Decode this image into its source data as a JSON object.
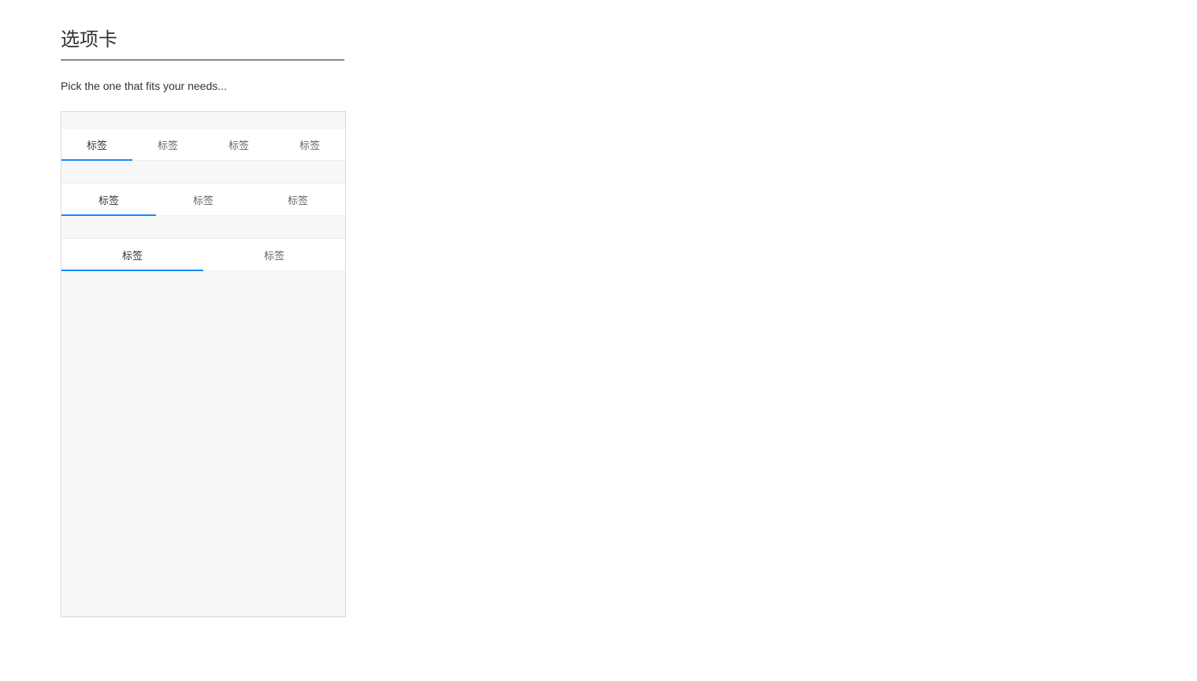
{
  "page": {
    "title": "选项卡",
    "subtitle": "Pick the one that fits your needs..."
  },
  "tabGroups": [
    {
      "count": 4,
      "activeIndex": 0,
      "tabs": [
        {
          "label": "标签"
        },
        {
          "label": "标签"
        },
        {
          "label": "标签"
        },
        {
          "label": "标签"
        }
      ]
    },
    {
      "count": 3,
      "activeIndex": 0,
      "tabs": [
        {
          "label": "标签"
        },
        {
          "label": "标签"
        },
        {
          "label": "标签"
        }
      ]
    },
    {
      "count": 2,
      "activeIndex": 0,
      "tabs": [
        {
          "label": "标签"
        },
        {
          "label": "标签"
        }
      ]
    }
  ]
}
